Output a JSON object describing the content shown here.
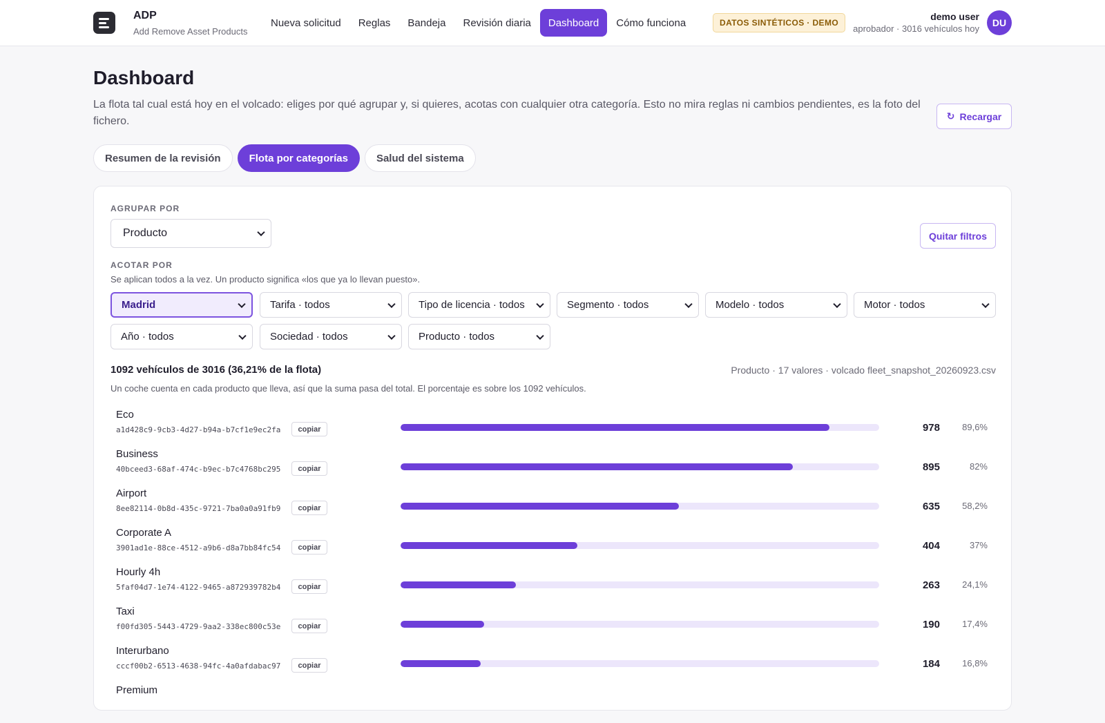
{
  "app": {
    "title": "ADP",
    "subtitle": "Add Remove Asset Products"
  },
  "nav": [
    "Nueva solicitud",
    "Reglas",
    "Bandeja",
    "Revisión diaria",
    "Dashboard",
    "Cómo funciona"
  ],
  "nav_active": "Dashboard",
  "demo_badge": "DATOS SINTÉTICOS · DEMO",
  "user": {
    "name": "demo user",
    "role": "aprobador · 3016 vehículos hoy",
    "initials": "DU"
  },
  "page": {
    "title": "Dashboard",
    "description": "La flota tal cual está hoy en el volcado: eliges por qué agrupar y, si quieres, acotas con cualquier otra categoría. Esto no mira reglas ni cambios pendientes, es la foto del fichero.",
    "reload_label": "Recargar"
  },
  "tabs": [
    "Resumen de la revisión",
    "Flota por categorías",
    "Salud del sistema"
  ],
  "tab_active": "Flota por categorías",
  "group_by": {
    "label": "AGRUPAR POR",
    "value": "Producto"
  },
  "clear_filters_label": "Quitar filtros",
  "filters": {
    "label": "ACOTAR POR",
    "hint": "Se aplican todos a la vez. Un producto significa «los que ya lo llevan puesto».",
    "items": [
      "Madrid",
      "Tarifa · todos",
      "Tipo de licencia · todos",
      "Segmento · todos",
      "Modelo · todos",
      "Motor · todos",
      "Año · todos",
      "Sociedad · todos",
      "Producto · todos"
    ],
    "active_index": 0
  },
  "summary": {
    "headline": "1092 vehículos de 3016 (36,21% de la flota)",
    "meta": "Producto · 17 valores · volcado fleet_snapshot_20260923.csv",
    "note": "Un coche cuenta en cada producto que lleva, así que la suma pasa del total. El porcentaje es sobre los 1092 vehículos."
  },
  "copy_label": "copiar",
  "accent_color": "#6d3fd9",
  "products": [
    {
      "name": "Eco",
      "uuid": "a1d428c9-9cb3-4d27-b94a-b7cf1e9ec2fa",
      "count": 978,
      "pct_label": "89,6%",
      "pct": 89.6
    },
    {
      "name": "Business",
      "uuid": "40bceed3-68af-474c-b9ec-b7c4768bc295",
      "count": 895,
      "pct_label": "82%",
      "pct": 82
    },
    {
      "name": "Airport",
      "uuid": "8ee82114-0b8d-435c-9721-7ba0a0a91fb9",
      "count": 635,
      "pct_label": "58,2%",
      "pct": 58.2
    },
    {
      "name": "Corporate A",
      "uuid": "3901ad1e-88ce-4512-a9b6-d8a7bb84fc54",
      "count": 404,
      "pct_label": "37%",
      "pct": 37
    },
    {
      "name": "Hourly 4h",
      "uuid": "5faf04d7-1e74-4122-9465-a872939782b4",
      "count": 263,
      "pct_label": "24,1%",
      "pct": 24.1
    },
    {
      "name": "Taxi",
      "uuid": "f00fd305-5443-4729-9aa2-338ec800c53e",
      "count": 190,
      "pct_label": "17,4%",
      "pct": 17.4
    },
    {
      "name": "Interurbano",
      "uuid": "cccf00b2-6513-4638-94fc-4a0afdabac97",
      "count": 184,
      "pct_label": "16,8%",
      "pct": 16.8
    },
    {
      "name": "Premium"
    }
  ]
}
